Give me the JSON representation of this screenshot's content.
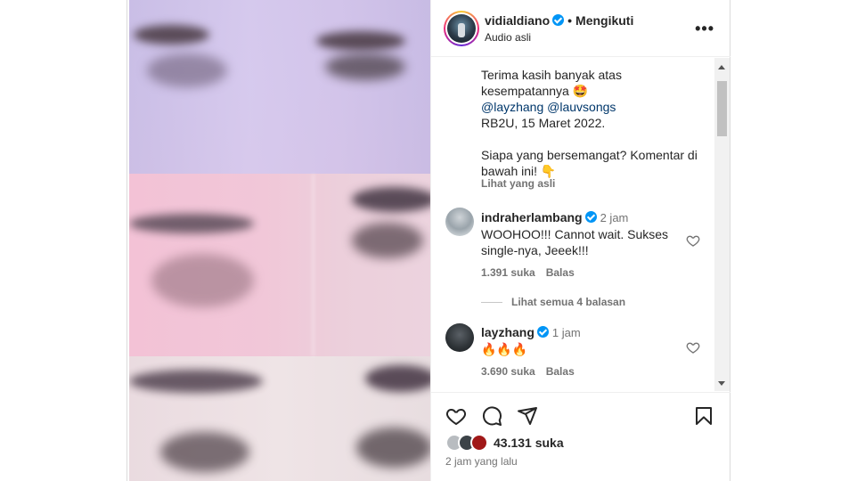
{
  "post": {
    "username": "vidialdiano",
    "follow_label": "Mengikuti",
    "separator": "•",
    "audio": "Audio asli",
    "more_label": "•••"
  },
  "caption": {
    "line1": "Terima kasih banyak atas",
    "line2": "kesempatannya 🤩",
    "mention1": "@layzhang",
    "mention2": "@lauvsongs",
    "line4": "RB2U, 15 Maret 2022.",
    "line5": "Siapa yang bersemangat? Komentar di",
    "line6": "bawah ini! 👇",
    "see_original": "Lihat yang asli"
  },
  "comments": [
    {
      "username": "indraherlambang",
      "time": "2 jam",
      "text": "WOOHOO!!! Cannot wait. Sukses single-nya, Jeeek!!!",
      "likes": "1.391 suka",
      "reply_label": "Balas"
    },
    {
      "username": "layzhang",
      "time": "1 jam",
      "text": "🔥🔥🔥",
      "likes": "3.690 suka",
      "reply_label": "Balas"
    }
  ],
  "replies_label": "Lihat semua 4 balasan",
  "footer": {
    "likes": "43.131 suka",
    "time_ago": "2 jam yang lalu"
  },
  "icons": {
    "like": "heart-icon",
    "comment": "comment-icon",
    "share": "send-icon",
    "save": "bookmark-icon"
  },
  "colors": {
    "verified": "#0095f6",
    "mention": "#00376b",
    "muted": "#737373"
  }
}
